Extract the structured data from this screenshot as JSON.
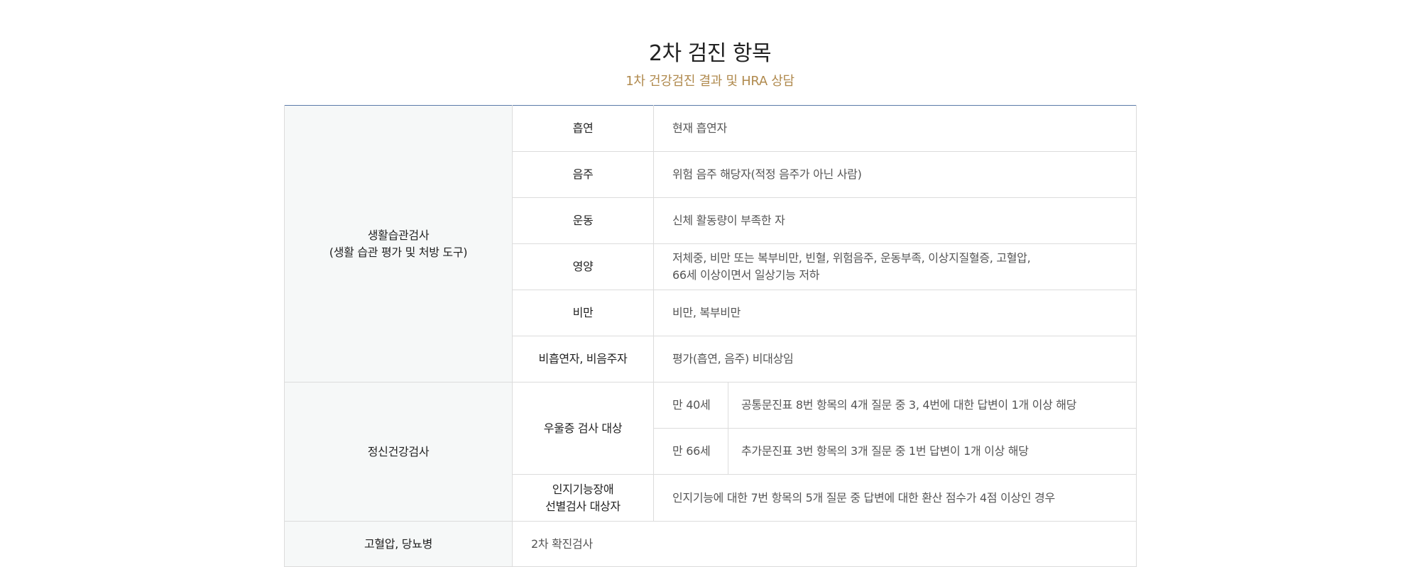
{
  "title": "2차 검진 항목",
  "subtitle": "1차 건강검진 결과 및 HRA 상담",
  "sections": {
    "lifestyle": {
      "category_line1": "생활습관검사",
      "category_line2": "(생활 습관 평가 및 처방 도구)",
      "rows": [
        {
          "label": "흡연",
          "desc": "현재 흡연자"
        },
        {
          "label": "음주",
          "desc": "위험 음주 해당자(적정 음주가 아닌 사람)"
        },
        {
          "label": "운동",
          "desc": "신체 활동량이 부족한 자"
        },
        {
          "label": "영양",
          "desc_line1": "저체중, 비만 또는 복부비만, 빈혈, 위험음주, 운동부족, 이상지질혈증, 고혈압,",
          "desc_line2": "66세 이상이면서 일상기능 저하"
        },
        {
          "label": "비만",
          "desc": "비만, 복부비만"
        },
        {
          "label": "비흡연자, 비음주자",
          "desc": "평가(흡연, 음주) 비대상임"
        }
      ]
    },
    "mental": {
      "category": "정신건강검사",
      "depression": {
        "label": "우울증 검사 대상",
        "rows": [
          {
            "age": "만 40세",
            "desc": "공통문진표 8번 항목의 4개 질문 중 3, 4번에 대한 답변이 1개 이상 해당"
          },
          {
            "age": "만 66세",
            "desc": "추가문진표 3번 항목의 3개 질문 중 1번 답변이 1개 이상 해당"
          }
        ]
      },
      "cognitive": {
        "label_line1": "인지기능장애",
        "label_line2": "선별검사 대상자",
        "desc": "인지기능에 대한 7번 항목의 5개 질문 중 답변에 대한 환산 점수가 4점 이상인 경우"
      }
    },
    "chronic": {
      "category": "고혈압, 당뇨병",
      "desc": "2차 확진검사"
    }
  }
}
